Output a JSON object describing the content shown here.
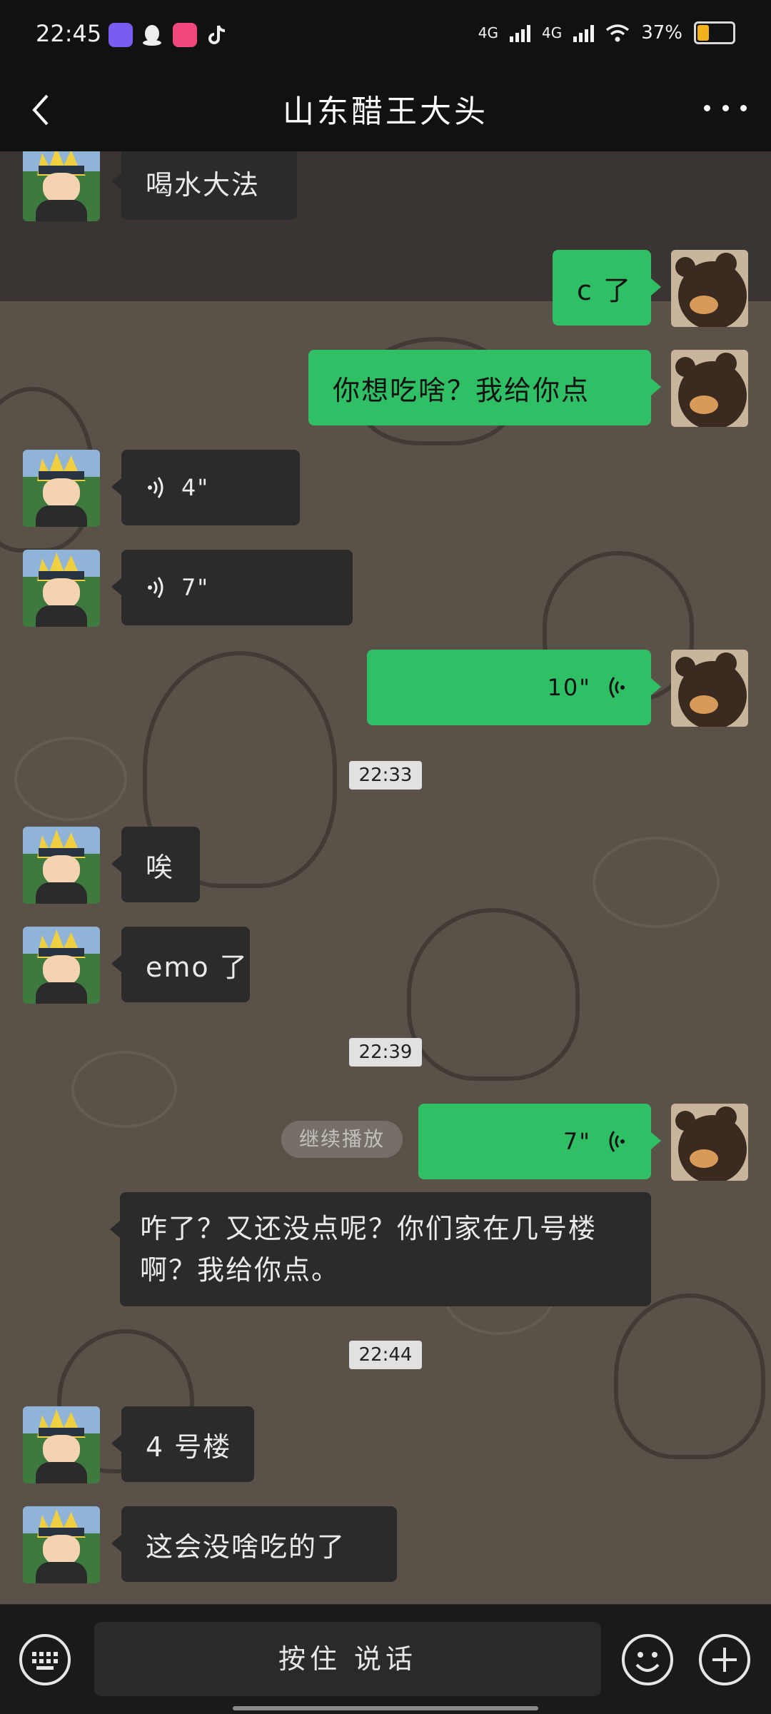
{
  "status_bar": {
    "time": "22:45",
    "net1": "4G",
    "net2": "4G",
    "battery": "37%"
  },
  "header": {
    "title": "山东醋王大头"
  },
  "messages": {
    "m1": "喝水大法",
    "m2": "c 了",
    "m3": "你想吃啥？我给你点",
    "v1": "4\"",
    "v2": "7\"",
    "v3": "10\"",
    "t1": "22:33",
    "m4": "唉",
    "m5": "emo 了",
    "t2": "22:39",
    "v4": "7\"",
    "resume": "继续播放",
    "m6": "咋了？又还没点呢？你们家在几号楼啊？我给你点。",
    "t3": "22:44",
    "m7": "4 号楼",
    "m8": "这会没啥吃的了"
  },
  "input": {
    "hold_to_talk": "按住 说话"
  },
  "colors": {
    "sent": "#2fbf65",
    "received": "#2b2b2b",
    "bar": "#111111"
  }
}
